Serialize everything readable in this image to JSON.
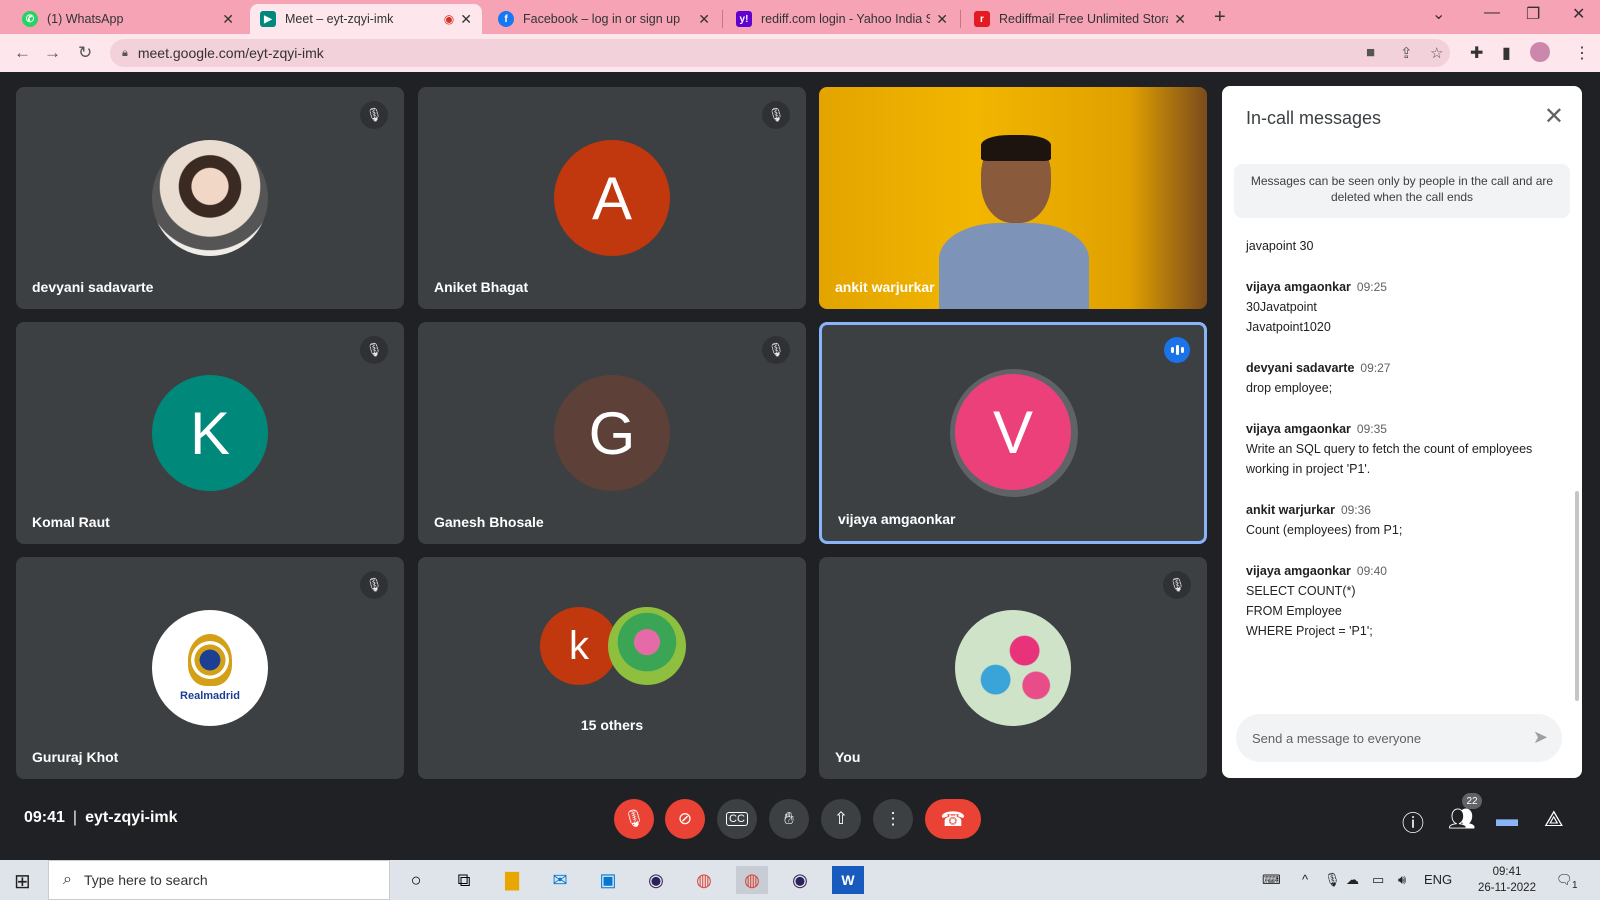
{
  "browser": {
    "tabs": [
      {
        "label": "(1) WhatsApp",
        "icon": "whatsapp-icon",
        "color": "#25d366"
      },
      {
        "label": "Meet – eyt-zqyi-imk",
        "icon": "google-meet-icon",
        "color": "#00897b"
      },
      {
        "label": "Facebook – log in or sign up",
        "icon": "facebook-icon",
        "color": "#1877f2"
      },
      {
        "label": "rediff.com login - Yahoo India Se",
        "icon": "yahoo-icon",
        "color": "#6001d2"
      },
      {
        "label": "Rediffmail Free Unlimited Storag",
        "icon": "rediff-icon",
        "color": "#e31b23"
      }
    ],
    "url": "meet.google.com/eyt-zqyi-imk"
  },
  "participants": [
    {
      "name": "devyani sadavarte",
      "avatar": "photo",
      "muted": true
    },
    {
      "name": "Aniket Bhagat",
      "avatar_letter": "A",
      "avatar_color": "#c1370e",
      "muted": true
    },
    {
      "name": "ankit warjurkar",
      "avatar": "video",
      "muted": false
    },
    {
      "name": "Komal Raut",
      "avatar_letter": "K",
      "avatar_color": "#00897b",
      "muted": true
    },
    {
      "name": "Ganesh Bhosale",
      "avatar_letter": "G",
      "avatar_color": "#5d4037",
      "muted": true
    },
    {
      "name": "vijaya amgaonkar",
      "avatar_letter": "V",
      "avatar_color": "#ec407a",
      "speaking": true
    },
    {
      "name": "Gururaj Khot",
      "avatar": "realmadrid-logo",
      "logo_text": "Realmadrid",
      "muted": true
    },
    {
      "name": "15 others",
      "avatar_letter": "k",
      "avatar_color": "#c1370e"
    },
    {
      "name": "You",
      "avatar": "flowers-photo",
      "muted": true
    }
  ],
  "chat": {
    "title": "In-call messages",
    "notice": "Messages can be seen only by people in the call and are deleted when the call ends",
    "messages": [
      {
        "sender": "",
        "time": "",
        "lines": [
          "javapoint 30"
        ]
      },
      {
        "sender": "vijaya amgaonkar",
        "time": "09:25",
        "lines": [
          "30Javatpoint",
          "Javatpoint1020"
        ]
      },
      {
        "sender": "devyani sadavarte",
        "time": "09:27",
        "lines": [
          "drop employee;"
        ]
      },
      {
        "sender": "vijaya amgaonkar",
        "time": "09:35",
        "lines": [
          "Write an SQL query to fetch the count of employees",
          "working in project 'P1'."
        ]
      },
      {
        "sender": "ankit warjurkar",
        "time": "09:36",
        "lines": [
          "Count (employees) from P1;"
        ]
      },
      {
        "sender": "vijaya amgaonkar",
        "time": "09:40",
        "lines": [
          "SELECT COUNT(*)",
          "FROM Employee",
          "WHERE Project = 'P1';"
        ]
      }
    ],
    "input_placeholder": "Send a message to everyone"
  },
  "callbar": {
    "time": "09:41",
    "meeting_code": "eyt-zqyi-imk",
    "participant_count": "22"
  },
  "taskbar": {
    "search_placeholder": "Type here to search",
    "language": "ENG",
    "clock_time": "09:41",
    "clock_date": "26-11-2022",
    "notification_count": "1"
  }
}
